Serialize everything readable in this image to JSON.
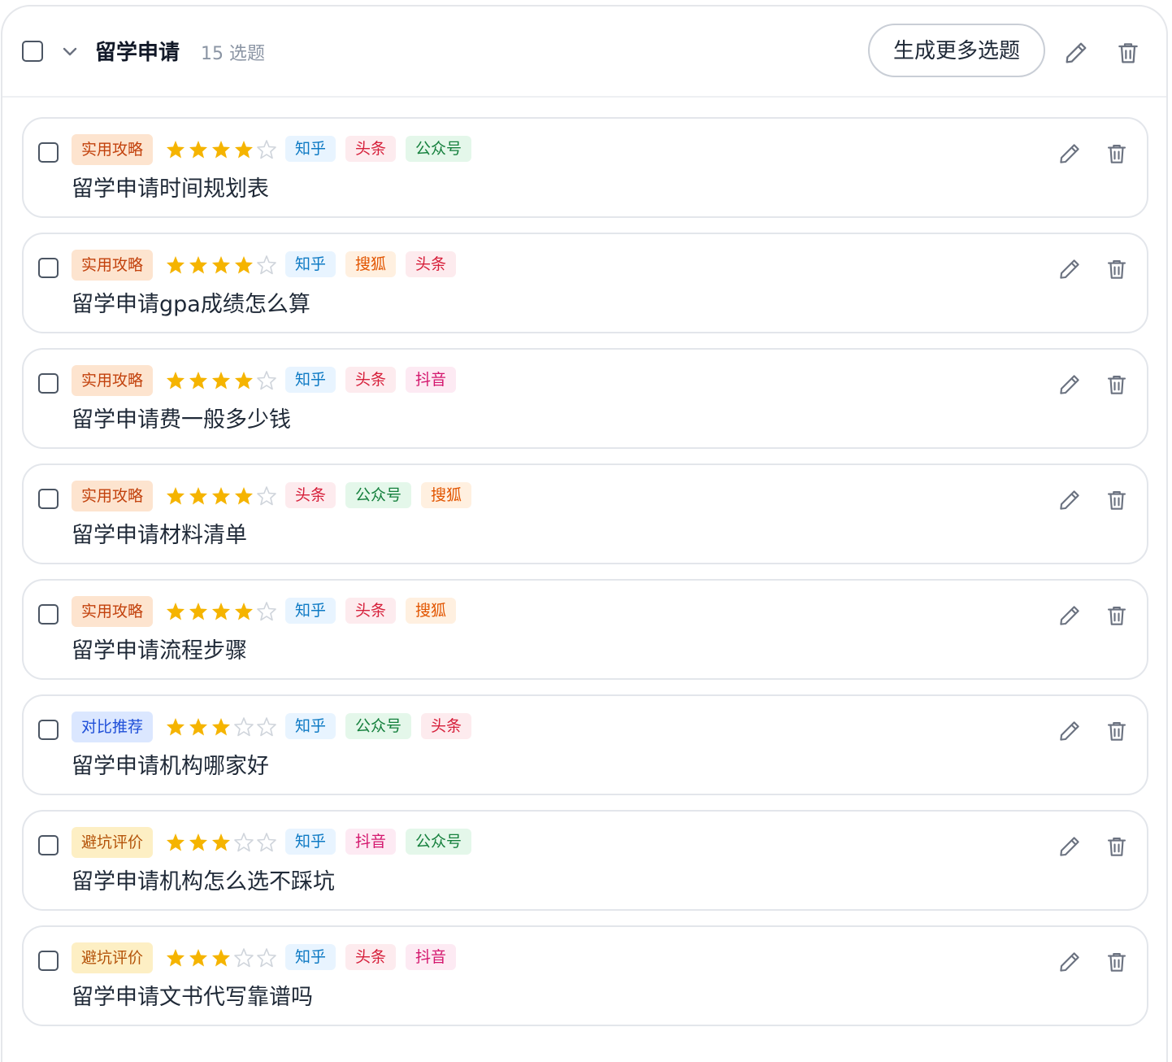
{
  "group": {
    "title": "留学申请",
    "count": "15 选题",
    "generate_label": "生成更多选题"
  },
  "colors": {
    "star_filled": "#f5b400",
    "star_empty": "#cfd4db",
    "icon": "#6b7280"
  },
  "category_styles": {
    "实用攻略": {
      "bg": "#fde4cf",
      "fg": "#c2410c"
    },
    "对比推荐": {
      "bg": "#dbe7ff",
      "fg": "#1d4ed8"
    },
    "避坑评价": {
      "bg": "#fdefc4",
      "fg": "#b45309"
    }
  },
  "platform_styles": {
    "知乎": {
      "bg": "#e8f4ff",
      "fg": "#0e7ac4"
    },
    "头条": {
      "bg": "#fdebee",
      "fg": "#d61f3a"
    },
    "公众号": {
      "bg": "#e4f7ea",
      "fg": "#15803d"
    },
    "搜狐": {
      "bg": "#fff0e0",
      "fg": "#e25500"
    },
    "抖音": {
      "bg": "#fdeaf3",
      "fg": "#d4176e"
    }
  },
  "items": [
    {
      "category": "实用攻略",
      "rating": 4,
      "max_rating": 5,
      "platforms": [
        "知乎",
        "头条",
        "公众号"
      ],
      "title": "留学申请时间规划表"
    },
    {
      "category": "实用攻略",
      "rating": 4,
      "max_rating": 5,
      "platforms": [
        "知乎",
        "搜狐",
        "头条"
      ],
      "title": "留学申请gpa成绩怎么算"
    },
    {
      "category": "实用攻略",
      "rating": 4,
      "max_rating": 5,
      "platforms": [
        "知乎",
        "头条",
        "抖音"
      ],
      "title": "留学申请费一般多少钱"
    },
    {
      "category": "实用攻略",
      "rating": 4,
      "max_rating": 5,
      "platforms": [
        "头条",
        "公众号",
        "搜狐"
      ],
      "title": "留学申请材料清单"
    },
    {
      "category": "实用攻略",
      "rating": 4,
      "max_rating": 5,
      "platforms": [
        "知乎",
        "头条",
        "搜狐"
      ],
      "title": "留学申请流程步骤"
    },
    {
      "category": "对比推荐",
      "rating": 3,
      "max_rating": 5,
      "platforms": [
        "知乎",
        "公众号",
        "头条"
      ],
      "title": "留学申请机构哪家好"
    },
    {
      "category": "避坑评价",
      "rating": 3,
      "max_rating": 5,
      "platforms": [
        "知乎",
        "抖音",
        "公众号"
      ],
      "title": "留学申请机构怎么选不踩坑"
    },
    {
      "category": "避坑评价",
      "rating": 3,
      "max_rating": 5,
      "platforms": [
        "知乎",
        "头条",
        "抖音"
      ],
      "title": "留学申请文书代写靠谱吗"
    }
  ]
}
